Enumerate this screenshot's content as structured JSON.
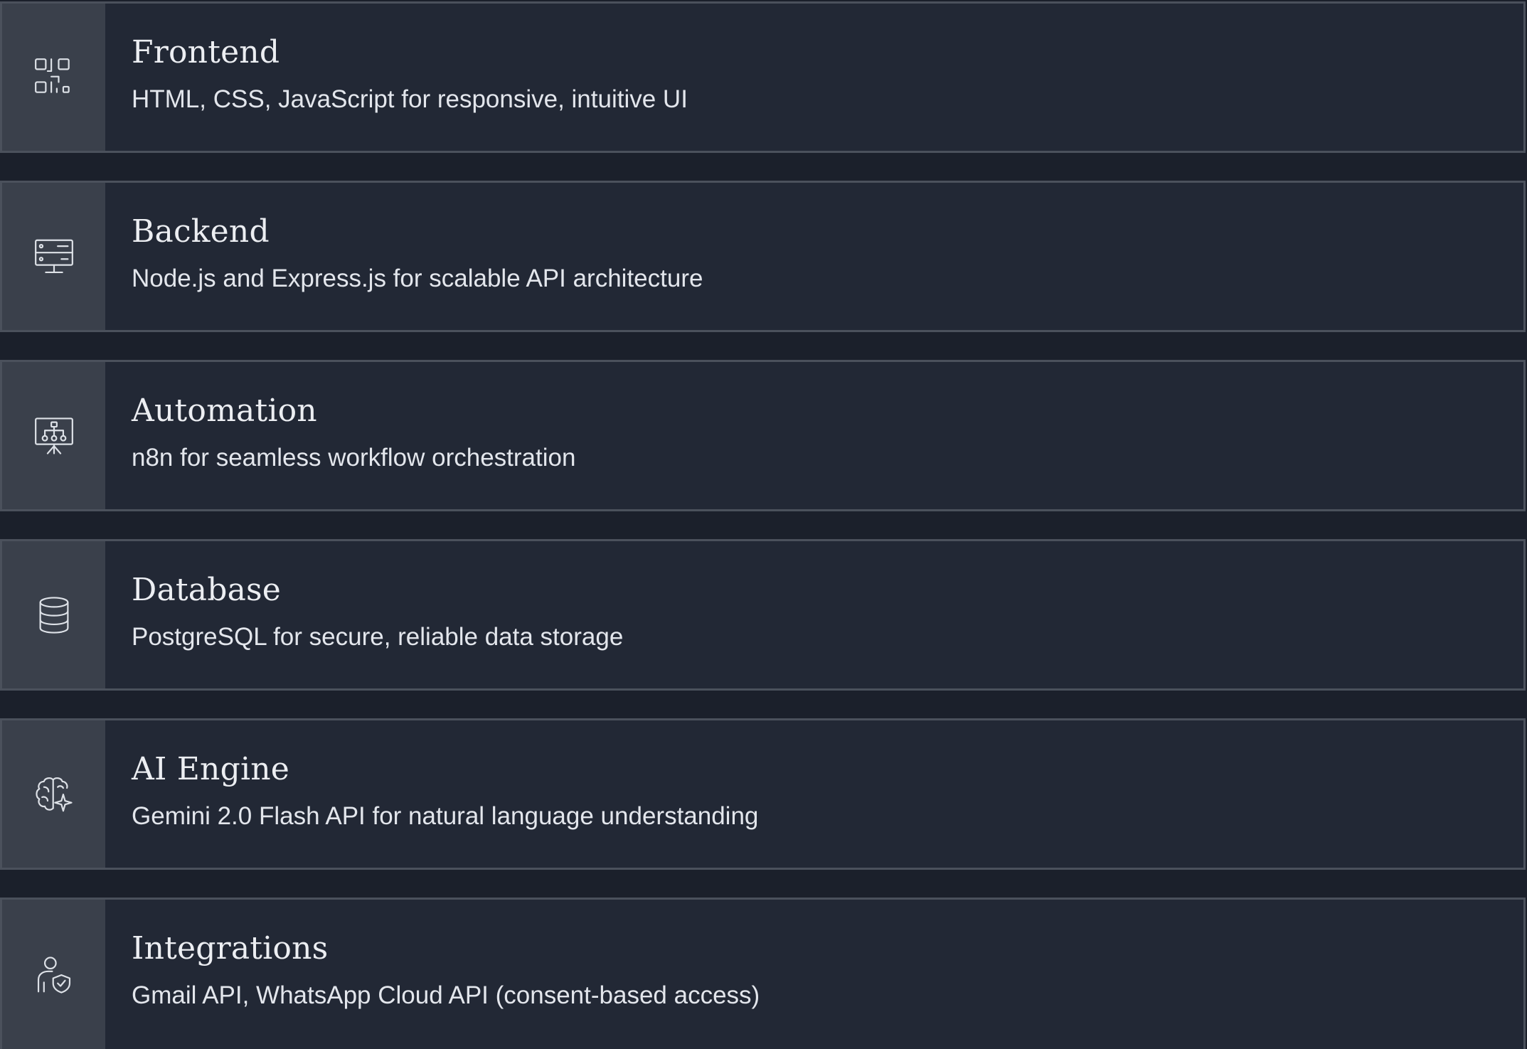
{
  "cards": [
    {
      "icon": "qr-code-icon",
      "title": "Frontend",
      "description": "HTML, CSS, JavaScript for responsive, intuitive UI"
    },
    {
      "icon": "server-monitor-icon",
      "title": "Backend",
      "description": "Node.js and Express.js for scalable API architecture"
    },
    {
      "icon": "workflow-presentation-icon",
      "title": "Automation",
      "description": "n8n for seamless workflow orchestration"
    },
    {
      "icon": "database-icon",
      "title": "Database",
      "description": "PostgreSQL for secure, reliable data storage"
    },
    {
      "icon": "brain-sparkle-icon",
      "title": "AI Engine",
      "description": "Gemini 2.0 Flash API for natural language understanding"
    },
    {
      "icon": "user-shield-icon",
      "title": "Integrations",
      "description": "Gmail API, WhatsApp Cloud API (consent-based access)"
    }
  ]
}
